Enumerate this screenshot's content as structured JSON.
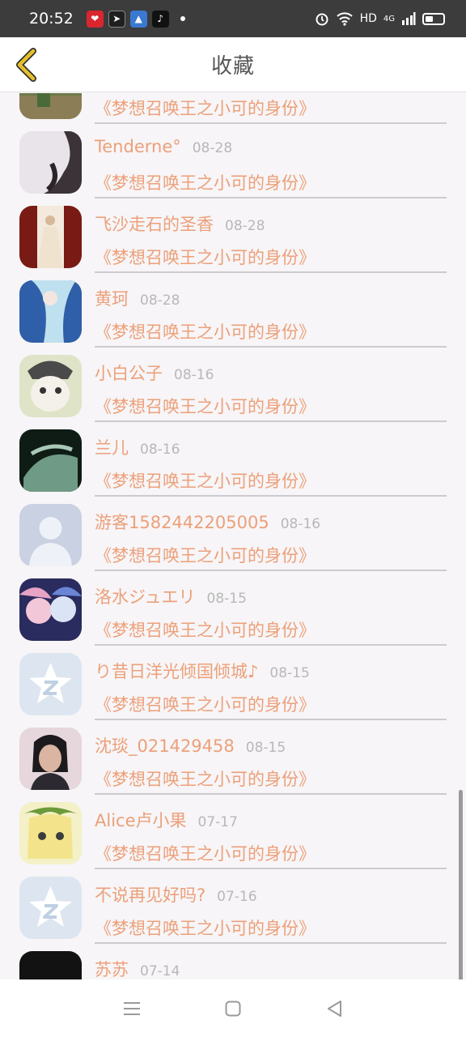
{
  "status_bar": {
    "time": "20:52",
    "network": "HD",
    "signal": "4G"
  },
  "header": {
    "title": "收藏",
    "back_icon": "chevron-left-icon"
  },
  "favorites": [
    {
      "title": "《梦想召唤王之小可的身份》"
    },
    {
      "name": "Tenderne°",
      "date": "08-28",
      "title": "《梦想召唤王之小可的身份》"
    },
    {
      "name": "飞沙走石的圣香",
      "date": "08-28",
      "title": "《梦想召唤王之小可的身份》"
    },
    {
      "name": "黄珂",
      "date": "08-28",
      "title": "《梦想召唤王之小可的身份》"
    },
    {
      "name": "小白公子",
      "date": "08-16",
      "title": "《梦想召唤王之小可的身份》"
    },
    {
      "name": "兰儿",
      "date": "08-16",
      "title": "《梦想召唤王之小可的身份》"
    },
    {
      "name": "游客1582442205005",
      "date": "08-16",
      "title": "《梦想召唤王之小可的身份》"
    },
    {
      "name": "洛水ジュエリ",
      "date": "08-15",
      "title": "《梦想召唤王之小可的身份》"
    },
    {
      "name": "り昔日洋光倾国倾城♪",
      "date": "08-15",
      "title": "《梦想召唤王之小可的身份》"
    },
    {
      "name": "沈琰_021429458",
      "date": "08-15",
      "title": "《梦想召唤王之小可的身份》"
    },
    {
      "name": "Alice卢小果",
      "date": "07-17",
      "title": "《梦想召唤王之小可的身份》"
    },
    {
      "name": "不说再见好吗?",
      "date": "07-16",
      "title": "《梦想召唤王之小可的身份》"
    },
    {
      "name": "苏苏",
      "date": "07-14"
    }
  ],
  "nav": {
    "menu_icon": "menu-icon",
    "home_icon": "home-square-icon",
    "back_icon": "back-triangle-icon"
  },
  "colors": {
    "accent_text": "#eca07a",
    "date_text": "#b8b8b8",
    "back_chevron": "#e6c02a"
  }
}
